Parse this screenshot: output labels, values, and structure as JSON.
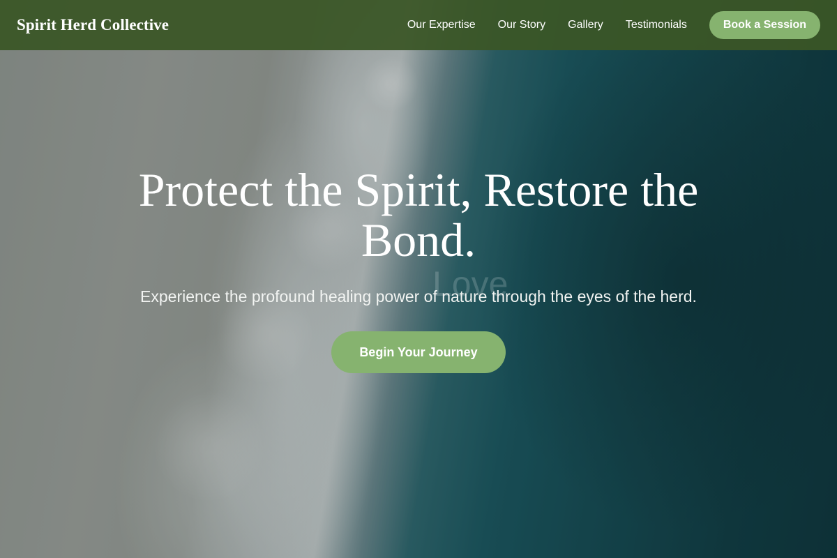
{
  "header": {
    "brand": "Spirit Herd Collective",
    "nav": [
      {
        "label": "Our Expertise"
      },
      {
        "label": "Our Story"
      },
      {
        "label": "Gallery"
      },
      {
        "label": "Testimonials"
      }
    ],
    "book_label": "Book a Session"
  },
  "hero": {
    "title": "Protect the Spirit, Restore the Bond.",
    "subtitle": "Experience the profound healing power of nature through the eyes of the herd.",
    "cta_label": "Begin Your Journey",
    "watermark": "Love"
  },
  "colors": {
    "nav_bg": "#3a5626",
    "accent": "#86b36f",
    "text": "#ffffff"
  }
}
